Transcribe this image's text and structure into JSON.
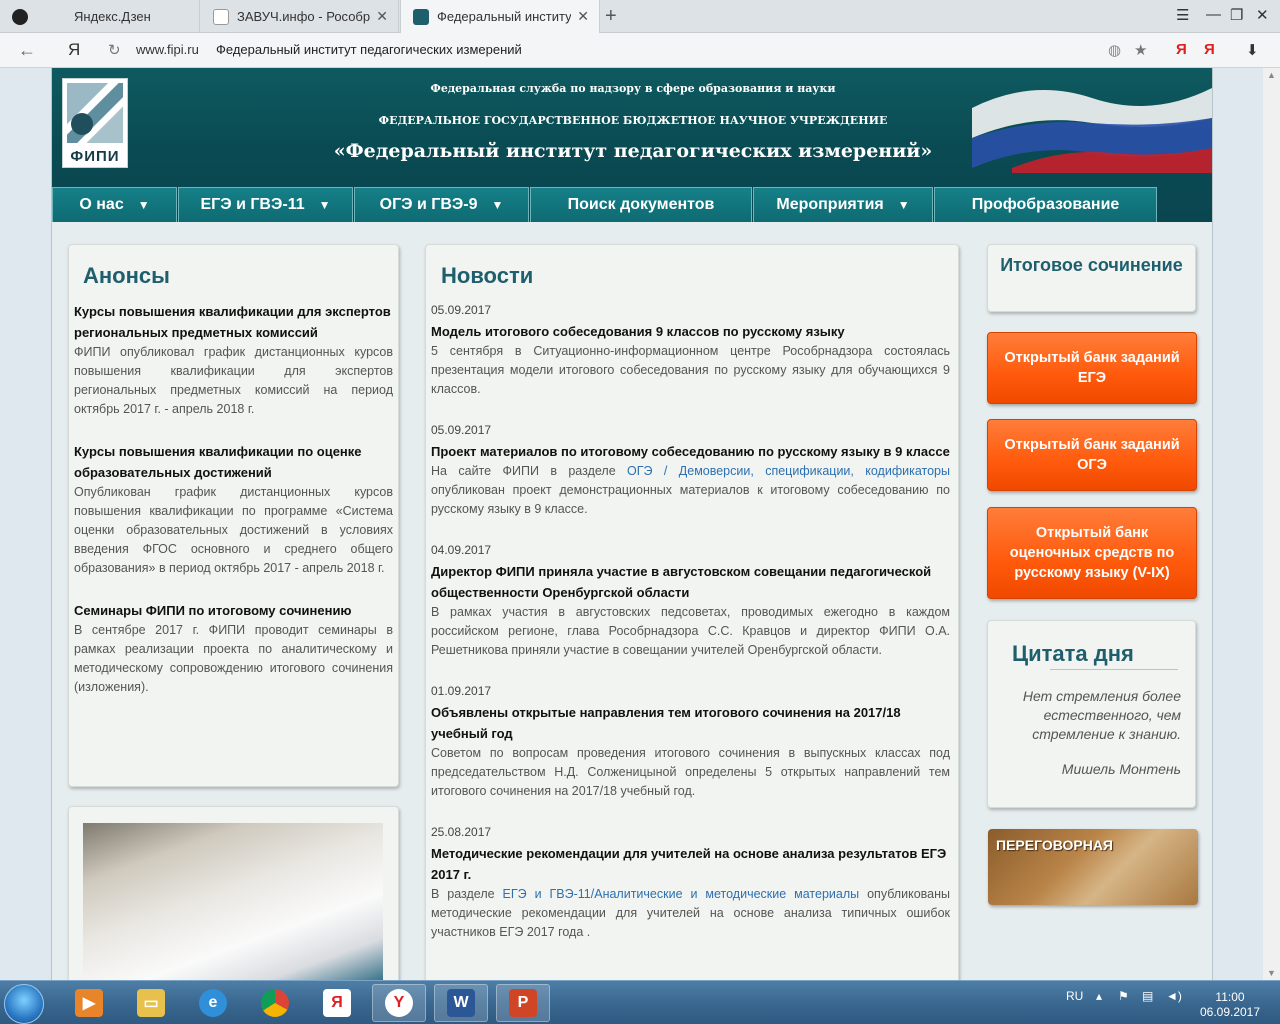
{
  "browser": {
    "tabs": [
      {
        "label": "Яндекс.Дзен",
        "icon": "zen-icon",
        "color": "#222222"
      },
      {
        "label": "ЗАВУЧ.инфо - Рособрнадзо",
        "icon": "page-icon",
        "color": "#ffffff"
      },
      {
        "label": "Федеральный институт п",
        "icon": "fipi-icon",
        "color": "#1f5f6d"
      }
    ],
    "new_tab": "+",
    "url": "www.fipi.ru",
    "page_title": "Федеральный институт педагогических измерений",
    "yandex_logo": "Я"
  },
  "header": {
    "logo_text": "ФИПИ",
    "line1": "Федеральная служба по надзору в сфере образования и науки",
    "line2": "ФЕДЕРАЛЬНОЕ ГОСУДАРСТВЕННОЕ БЮДЖЕТНОЕ НАУЧНОЕ УЧРЕЖДЕНИЕ",
    "line3": "«Федеральный институт педагогических измерений»"
  },
  "nav": [
    {
      "label": "О нас",
      "dropdown": true
    },
    {
      "label": "ЕГЭ и ГВЭ-11",
      "dropdown": true
    },
    {
      "label": "ОГЭ и ГВЭ-9",
      "dropdown": true
    },
    {
      "label": "Поиск документов",
      "dropdown": false
    },
    {
      "label": "Мероприятия",
      "dropdown": true
    },
    {
      "label": "Профобразование",
      "dropdown": false
    }
  ],
  "anons": {
    "title": "Анонсы",
    "items": [
      {
        "title": "Курсы повышения квалификации для экспертов региональных предметных комиссий",
        "text": "ФИПИ опубликовал график дистанционных курсов повышения квалификации для экспертов региональных предметных комиссий на период октябрь 2017 г. - апрель 2018 г."
      },
      {
        "title": "Курсы повышения квалификации по оценке образовательных достижений",
        "text": "Опубликован график дистанционных курсов повышения квалификации по программе «Система оценки образовательных достижений в условиях введения ФГОС основного и среднего общего образования» в период октябрь 2017 - апрель 2018 г."
      },
      {
        "title": "Семинары ФИПИ по итоговому сочинению",
        "text": "В сентябре 2017 г. ФИПИ проводит семинары в рамках реализации проекта по аналитическому и методическому сопровождению итогового сочинения (изложения)."
      }
    ]
  },
  "news": {
    "title": "Новости",
    "items": [
      {
        "date": "05.09.2017",
        "title": "Модель итогового собеседования 9 классов по русскому языку",
        "text": "5 сентября в Ситуационно-информационном центре Рособрнадзора состоялась презентация модели итогового собеседования по русскому языку для обучающихся 9 классов."
      },
      {
        "date": "05.09.2017",
        "title": "Проект материалов по итоговому собеседованию по русскому языку в 9 классе",
        "text_before": "На сайте ФИПИ в разделе ",
        "link": "ОГЭ / Демоверсии, спецификации, кодификаторы",
        "text_after": " опубликован проект демонстрационных материалов к итоговому собеседованию по русскому языку в 9 классе."
      },
      {
        "date": "04.09.2017",
        "title": "Директор ФИПИ приняла участие в августовском совещании педагогической общественности Оренбургской области",
        "text": "В рамках участия в августовских педсоветах, проводимых ежегодно в каждом российском регионе, глава Рособрнадзора С.С. Кравцов и директор ФИПИ О.А. Решетникова приняли участие в совещании учителей Оренбургской области."
      },
      {
        "date": "01.09.2017",
        "title": "Объявлены открытые направления тем итогового сочинения на 2017/18 учебный год",
        "text": "Советом по вопросам проведения итогового сочинения в выпускных классах под председательством Н.Д. Солженицыной определены 5 открытых направлений тем итогового сочинения на 2017/18 учебный год."
      },
      {
        "date": "25.08.2017",
        "title": "Методические рекомендации для учителей на основе анализа результатов ЕГЭ 2017 г.",
        "text_before": "В разделе ",
        "link": "ЕГЭ и ГВЭ-11/Аналитические и методические материалы",
        "text_after": " опубликованы методические рекомендации для учителей на основе анализа типичных ошибок участников ЕГЭ 2017 года ."
      }
    ]
  },
  "sidebar": {
    "essay": "Итоговое сочинение",
    "buttons": [
      "Открытый банк заданий ЕГЭ",
      "Открытый банк заданий ОГЭ",
      "Открытый банк оценочных средств по русскому языку (V-IX)"
    ],
    "quote_title": "Цитата дня",
    "quote_text": "Нет стремления более естественного, чем стремление к знанию.",
    "quote_author": "Мишель Монтень",
    "negotiation": "ПЕРЕГОВОРНАЯ"
  },
  "taskbar": {
    "lang": "RU",
    "time": "11:00",
    "date": "06.09.2017",
    "apps": [
      "media-player-icon",
      "explorer-icon",
      "ie-icon",
      "chrome-icon",
      "yandex-icon",
      "yandex-browser-icon",
      "word-icon",
      "powerpoint-icon"
    ]
  },
  "colors": {
    "header_teal": "#0e5a60",
    "nav_teal": "#168088",
    "title_teal": "#1f5f6d",
    "orange": "#ff5a0c",
    "link": "#2e70b0"
  }
}
